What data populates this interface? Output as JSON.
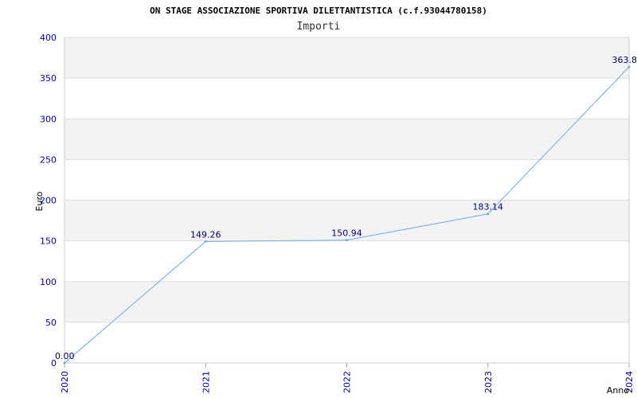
{
  "chart_data": {
    "type": "line",
    "title": "ON STAGE ASSOCIAZIONE SPORTIVA DILETTANTISTICA (c.f.93044780158)",
    "subtitle": "Importi",
    "xlabel": "Anno",
    "ylabel": "Euro",
    "categories": [
      "2020",
      "2021",
      "2022",
      "2023",
      "2024"
    ],
    "values": [
      0.0,
      149.26,
      150.94,
      183.14,
      363.8
    ],
    "value_labels": [
      "0.00",
      "149.26",
      "150.94",
      "183.14",
      "363.8"
    ],
    "ylim": [
      0,
      400
    ],
    "yticks": [
      0,
      50,
      100,
      150,
      200,
      250,
      300,
      350,
      400
    ],
    "ytick_labels": [
      "0",
      "50",
      "100",
      "150",
      "200",
      "250",
      "300",
      "350",
      "400"
    ],
    "grid": true,
    "colors": {
      "line": "#6aaaf0",
      "band": "#f3f3f3",
      "grid": "#dddddd",
      "tick_text": "#0000cc",
      "data_label": "#000080"
    }
  }
}
